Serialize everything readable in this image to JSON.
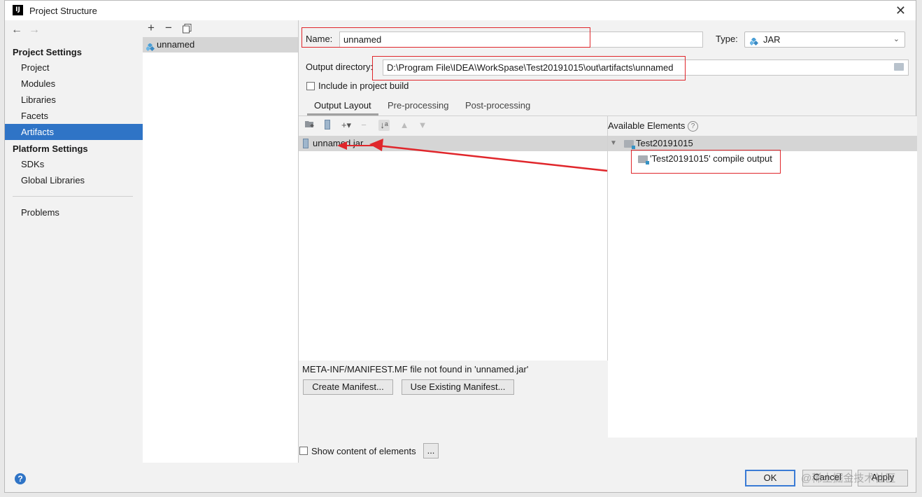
{
  "window": {
    "title": "Project Structure",
    "logo": "IJ"
  },
  "nav": {
    "back_icon": "arrow-left-icon",
    "forward_icon": "arrow-right-icon",
    "project_settings_heading": "Project Settings",
    "project_items": [
      "Project",
      "Modules",
      "Libraries",
      "Facets",
      "Artifacts"
    ],
    "selected": "Artifacts",
    "platform_settings_heading": "Platform Settings",
    "platform_items": [
      "SDKs",
      "Global Libraries"
    ],
    "problems": "Problems"
  },
  "artifact_list": {
    "toolbar": {
      "add": "+",
      "remove": "−",
      "copy_icon": "copy-icon"
    },
    "items": [
      "unnamed"
    ]
  },
  "form": {
    "name_label": "Name:",
    "name_value": "unnamed",
    "type_label": "Type:",
    "type_value": "JAR",
    "output_dir_label": "Output directory:",
    "output_dir_value": "D:\\Program File\\IDEA\\WorkSpase\\Test20191015\\out\\artifacts\\unnamed",
    "include_in_build": "Include in project build"
  },
  "tabs": [
    "Output Layout",
    "Pre-processing",
    "Post-processing"
  ],
  "output_layout": {
    "toolbar_icons": [
      "create-directory-icon",
      "archive-icon",
      "add-icon",
      "remove-icon",
      "sort-icon",
      "move-up-icon",
      "move-down-icon"
    ],
    "root_item": "unnamed.jar",
    "manifest_message": "META-INF/MANIFEST.MF file not found in 'unnamed.jar'",
    "create_manifest": "Create Manifest...",
    "use_existing_manifest": "Use Existing Manifest...",
    "show_content": "Show content of elements",
    "more": "..."
  },
  "available_elements": {
    "title": "Available Elements",
    "help": "?",
    "tree": [
      {
        "label": "Test20191015",
        "expanded": true
      },
      {
        "label": "'Test20191015' compile output"
      }
    ]
  },
  "footer": {
    "help": "?",
    "ok": "OK",
    "cancel": "Cancel",
    "apply": "Apply",
    "watermark": "@稀土掘金技术社区"
  },
  "colors": {
    "selection": "#2f74c6",
    "annotation_red": "#e0262b",
    "jar_icon": "#4a9fd6"
  }
}
